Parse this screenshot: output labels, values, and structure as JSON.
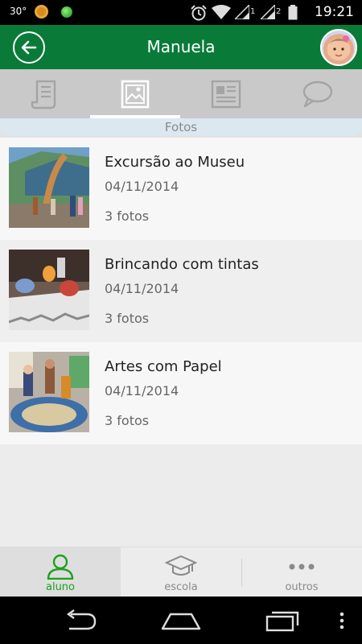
{
  "statusbar": {
    "temperature": "30°",
    "sim1": "1",
    "sim2": "2",
    "time": "19:21",
    "icons": [
      "notification-app-icon",
      "green-dot-icon",
      "alarm-icon",
      "wifi-icon",
      "signal-icon",
      "signal-icon",
      "battery-icon"
    ]
  },
  "appbar": {
    "title": "Manuela",
    "back_icon": "arrow-left-icon",
    "avatar": "child-avatar"
  },
  "tabs": [
    {
      "icon": "scroll-icon",
      "active": false
    },
    {
      "icon": "image-icon",
      "active": true
    },
    {
      "icon": "newspaper-icon",
      "active": false
    },
    {
      "icon": "chat-bubble-icon",
      "active": false
    }
  ],
  "section": {
    "title": "Fotos"
  },
  "albums": [
    {
      "title": "Excursão ao Museu",
      "date": "04/11/2014",
      "count": "3 fotos"
    },
    {
      "title": "Brincando com tintas",
      "date": "04/11/2014",
      "count": "3 fotos"
    },
    {
      "title": "Artes com Papel",
      "date": "04/11/2014",
      "count": "3 fotos"
    }
  ],
  "bottomnav": [
    {
      "label": "aluno",
      "icon": "person-icon",
      "active": true
    },
    {
      "label": "escola",
      "icon": "graduation-cap-icon",
      "active": false
    },
    {
      "label": "outros",
      "icon": "more-dots-icon",
      "active": false
    }
  ],
  "colors": {
    "primary": "#0a7a39",
    "accent_active": "#1ea01e",
    "tab_bar": "#c9c9c9"
  }
}
